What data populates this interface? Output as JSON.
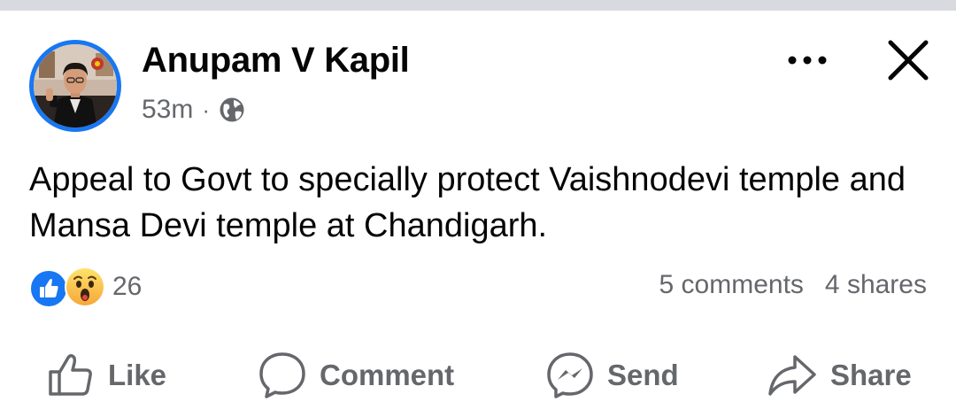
{
  "post": {
    "author": "Anupam V Kapil",
    "time": "53m",
    "separator": "·",
    "privacy_icon": "globe-icon",
    "text": "Appeal to Govt to specially protect Vaishnodevi temple and Mansa Devi temple at Chandigarh."
  },
  "reactions": {
    "icons": [
      "like-icon",
      "wow-icon"
    ],
    "count": "26"
  },
  "counts": {
    "comments": "5 comments",
    "shares": "4 shares"
  },
  "actions": {
    "like": "Like",
    "comment": "Comment",
    "send": "Send",
    "share": "Share"
  },
  "colors": {
    "accent": "#1877f2",
    "secondary_text": "#65676b",
    "primary_text": "#050505"
  }
}
